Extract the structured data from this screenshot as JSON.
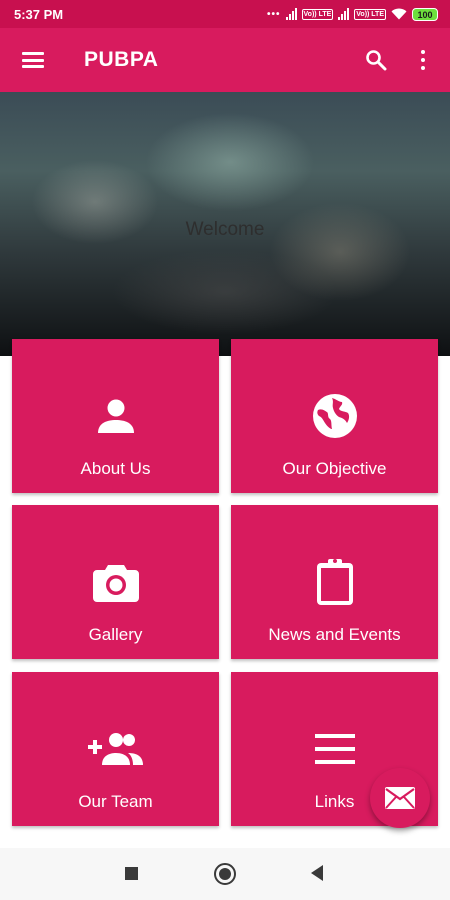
{
  "status_bar": {
    "time": "5:37 PM",
    "network_label_1": "Vo)) LTE",
    "network_label_2": "Vo)) LTE",
    "battery": "100"
  },
  "app_bar": {
    "title": "PUBPA",
    "icons": [
      "menu-icon",
      "search-icon",
      "more-vert-icon"
    ]
  },
  "hero": {
    "text": "Welcome"
  },
  "tiles": [
    {
      "label": "About Us",
      "icon": "person-icon"
    },
    {
      "label": "Our Objective",
      "icon": "globe-icon"
    },
    {
      "label": "Gallery",
      "icon": "camera-icon"
    },
    {
      "label": "News and Events",
      "icon": "clipboard-icon"
    },
    {
      "label": "Our Team",
      "icon": "add-group-icon"
    },
    {
      "label": "Links",
      "icon": "list-icon"
    }
  ],
  "fab": {
    "icon": "mail-icon"
  },
  "colors": {
    "primary": "#d81b5e",
    "status_bar": "#c8104f",
    "battery": "#6ddf3d"
  }
}
